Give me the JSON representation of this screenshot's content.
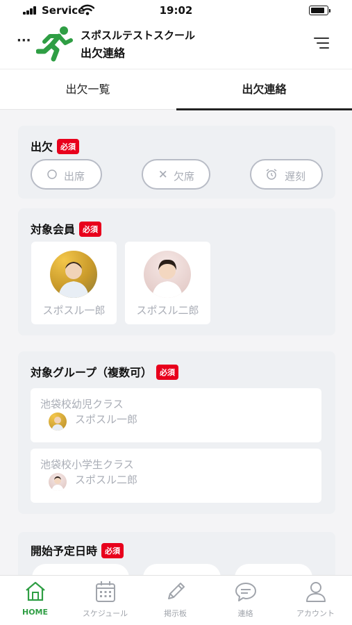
{
  "status_bar": {
    "carrier": "Service",
    "time": "19:02"
  },
  "header": {
    "more": "···",
    "school_name": "スポスルテストスクール",
    "title": "出欠連絡"
  },
  "tabs": [
    {
      "label": "出欠一覧",
      "active": false
    },
    {
      "label": "出欠連絡",
      "active": true
    }
  ],
  "attendance": {
    "title": "出欠",
    "required": "必須",
    "options": [
      {
        "icon": "circle-icon",
        "label": "出席"
      },
      {
        "icon": "cross-icon",
        "label": "欠席"
      },
      {
        "icon": "alarm-clock-icon",
        "label": "遅刻"
      }
    ]
  },
  "members": {
    "title": "対象会員",
    "required": "必須",
    "items": [
      {
        "name": "スポスル一郎"
      },
      {
        "name": "スポスル二郎"
      }
    ]
  },
  "groups": {
    "title": "対象グループ（複数可）",
    "required": "必須",
    "items": [
      {
        "name": "池袋校幼児クラス",
        "member": "スポスル一郎"
      },
      {
        "name": "池袋校小学生クラス",
        "member": "スポスル二郎"
      }
    ]
  },
  "start_time": {
    "title": "開始予定日時",
    "required": "必須"
  },
  "bottom_nav": [
    {
      "icon": "home-icon",
      "label": "HOME",
      "active": true
    },
    {
      "icon": "calendar-icon",
      "label": "スケジュール",
      "active": false
    },
    {
      "icon": "pencil-icon",
      "label": "掲示板",
      "active": false
    },
    {
      "icon": "chat-bubble-icon",
      "label": "連絡",
      "active": false
    },
    {
      "icon": "user-icon",
      "label": "アカウント",
      "active": false
    }
  ],
  "colors": {
    "brand_green": "#2f9e44",
    "required_red": "#e8001c",
    "card_bg": "#eef0f3"
  }
}
